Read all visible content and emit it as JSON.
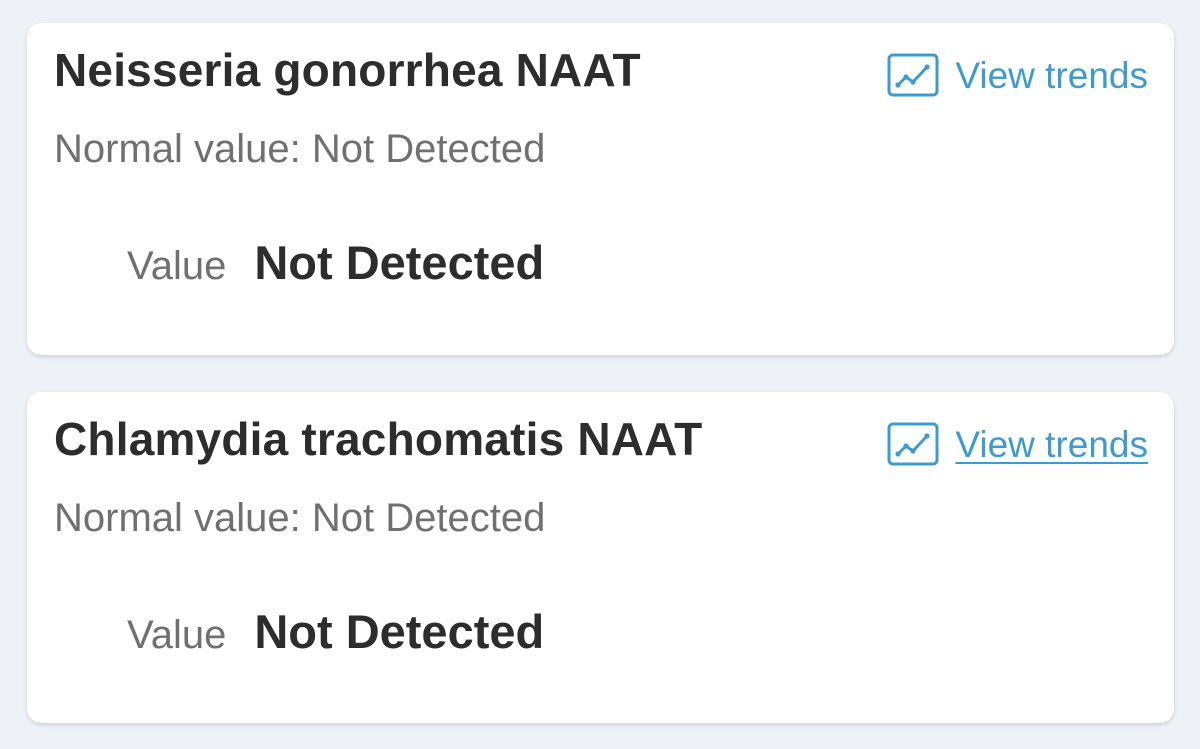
{
  "colors": {
    "background": "#eef1f6",
    "card": "#ffffff",
    "link": "#3d9bd0",
    "title_text": "#2d2d2d",
    "secondary_text": "#707070"
  },
  "results": [
    {
      "name": "Neisseria gonorrhea NAAT",
      "trends_label": "View trends",
      "trends_icon": "line-chart-icon",
      "normal_value": "Normal value: Not Detected",
      "value_label": "Value",
      "value": "Not Detected"
    },
    {
      "name": "Chlamydia trachomatis NAAT",
      "trends_label": "View trends",
      "trends_icon": "line-chart-icon",
      "normal_value": "Normal value: Not Detected",
      "value_label": "Value",
      "value": "Not Detected"
    }
  ]
}
